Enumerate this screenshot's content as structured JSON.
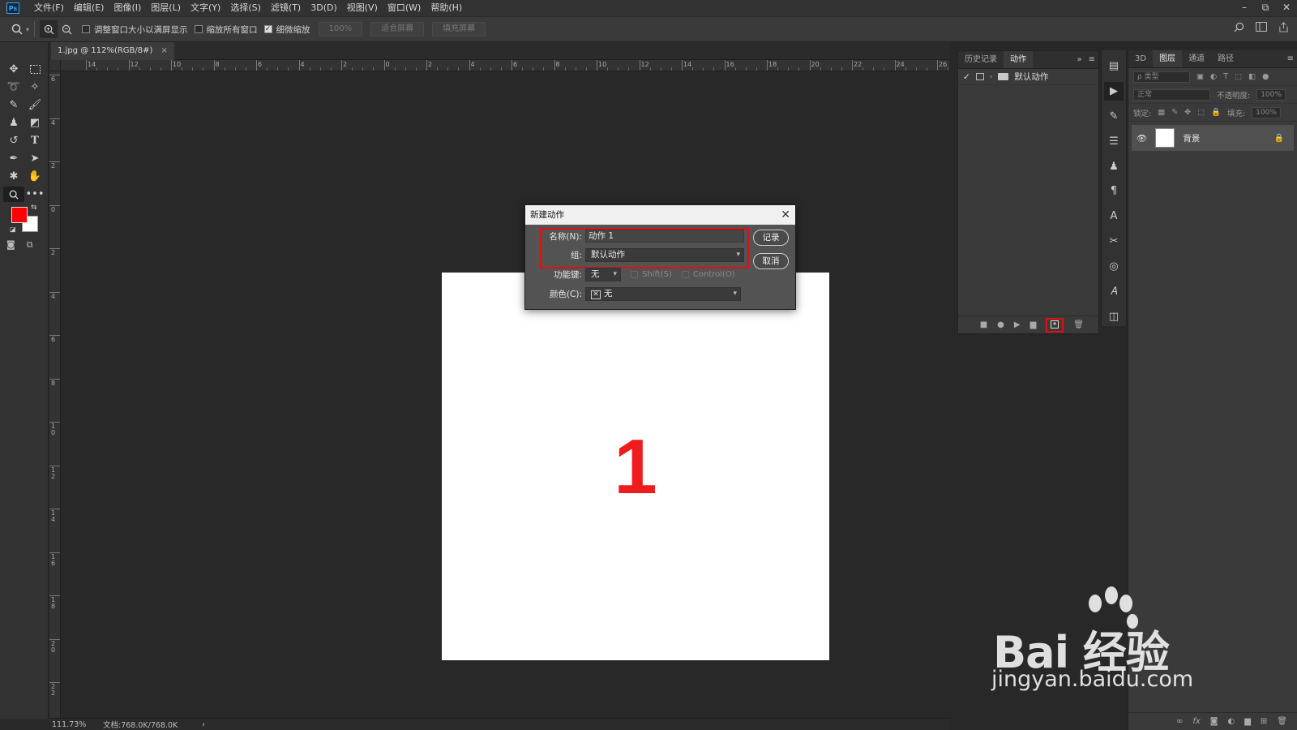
{
  "app": {
    "logo": "Ps",
    "menu": [
      "文件(F)",
      "编辑(E)",
      "图像(I)",
      "图层(L)",
      "文字(Y)",
      "选择(S)",
      "滤镜(T)",
      "3D(D)",
      "视图(V)",
      "窗口(W)",
      "帮助(H)"
    ],
    "window_controls": {
      "minimize": "–",
      "restore": "⧉",
      "close": "✕"
    }
  },
  "options_bar": {
    "resize_windows_label": "调整窗口大小以满屏显示",
    "resize_windows_checked": false,
    "zoom_all_label": "缩放所有窗口",
    "zoom_all_checked": false,
    "scrubby_zoom_label": "细微缩放",
    "scrubby_zoom_checked": true,
    "btn_100": "100%",
    "btn_fit": "适合屏幕",
    "btn_fill": "填充屏幕"
  },
  "document": {
    "tab_title": "1.jpg @ 112%(RGB/8#)",
    "tab_close": "×",
    "canvas_text": "1",
    "canvas_text_color": "#ee1c1c"
  },
  "rulers": {
    "horizontal": [
      "14",
      "12",
      "10",
      "8",
      "6",
      "4",
      "2",
      "0",
      "2",
      "4",
      "6",
      "8",
      "10",
      "12",
      "14",
      "16",
      "18",
      "20",
      "22",
      "24",
      "26"
    ],
    "vertical": [
      "6",
      "4",
      "2",
      "0",
      "2",
      "4",
      "6",
      "8",
      "10",
      "12",
      "14",
      "16",
      "18",
      "20",
      "22"
    ]
  },
  "status": {
    "zoom": "111.73%",
    "doc": "文档:768.0K/768.0K",
    "arrow": "›"
  },
  "actions_panel": {
    "tabs": [
      "历史记录",
      "动作"
    ],
    "active_tab": 1,
    "expand": "»",
    "menu": "≡",
    "items": [
      {
        "label": "默认动作",
        "checked": true
      }
    ]
  },
  "layers_panel": {
    "tabs": [
      "3D",
      "图层",
      "通道",
      "路径"
    ],
    "active_tab": 1,
    "filter_placeholder": "ρ 类型",
    "blend_mode": "正常",
    "opacity_label": "不透明度:",
    "opacity_value": "100%",
    "lock_label": "锁定:",
    "fill_label": "填充:",
    "fill_value": "100%",
    "layers": [
      {
        "name": "背景",
        "locked": true
      }
    ]
  },
  "dialog": {
    "title": "新建动作",
    "name_label": "名称(N):",
    "name_value": "动作 1",
    "group_label": "组:",
    "group_value": "默认动作",
    "fkey_label": "功能键:",
    "fkey_value": "无",
    "shift_label": "Shift(S)",
    "control_label": "Control(O)",
    "color_label": "颜色(C):",
    "color_value": "无",
    "record_button": "记录",
    "cancel_button": "取消"
  },
  "watermark": {
    "logo": "Bai 经验",
    "url": "jingyan.baidu.com"
  },
  "colors": {
    "foreground": "#ff0000",
    "background": "#ffffff",
    "highlight": "#e01010"
  }
}
